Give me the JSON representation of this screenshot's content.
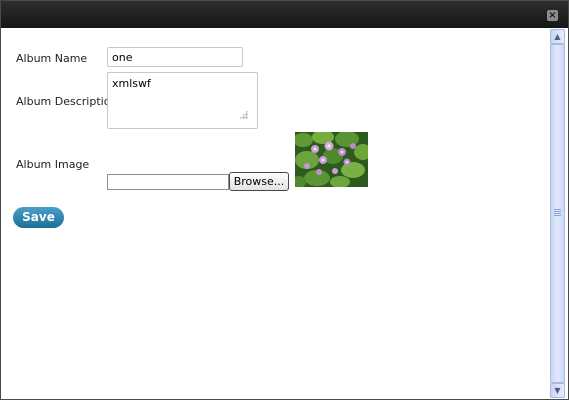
{
  "dialog": {
    "close_icon": "×"
  },
  "form": {
    "album_name_label": "Album Name",
    "album_name_value": "one",
    "album_description_label": "Album Description",
    "album_description_value": "xmlswf",
    "album_image_label": "Album Image",
    "browse_label": "Browse...",
    "save_label": "Save"
  },
  "thumbnail": {
    "description": ""
  },
  "scrollbar": {
    "up_arrow": "▲",
    "down_arrow": "▼"
  }
}
